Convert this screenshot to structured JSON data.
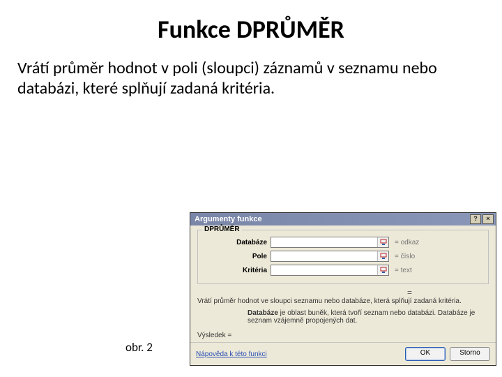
{
  "title": "Funkce DPRŮMĚR",
  "description": "Vrátí průměr hodnot v poli (sloupci) záznamů v seznamu nebo databázi, které splňují zadaná kritéria.",
  "caption": "obr. 2",
  "dialog": {
    "title": "Argumenty funkce",
    "help_icon": "?",
    "close_icon": "×",
    "legend": "DPRŮMĚR",
    "fields": {
      "db": {
        "label": "Databáze",
        "value": "",
        "rhs": "= odkaz"
      },
      "pole": {
        "label": "Pole",
        "value": "",
        "rhs": "= číslo"
      },
      "krit": {
        "label": "Kritéria",
        "value": "",
        "rhs": "= text"
      }
    },
    "eq": "=",
    "desc1": "Vrátí průměr hodnot ve sloupci seznamu nebo databáze, která splňují zadaná kritéria.",
    "desc2_label": "Databáze",
    "desc2_text": " je oblast buněk, která tvoří seznam nebo databázi. Databáze je seznam vzájemně propojených dat.",
    "result": "Výsledek =",
    "help_link": "Nápověda k této funkci",
    "ok": "OK",
    "cancel": "Storno"
  }
}
